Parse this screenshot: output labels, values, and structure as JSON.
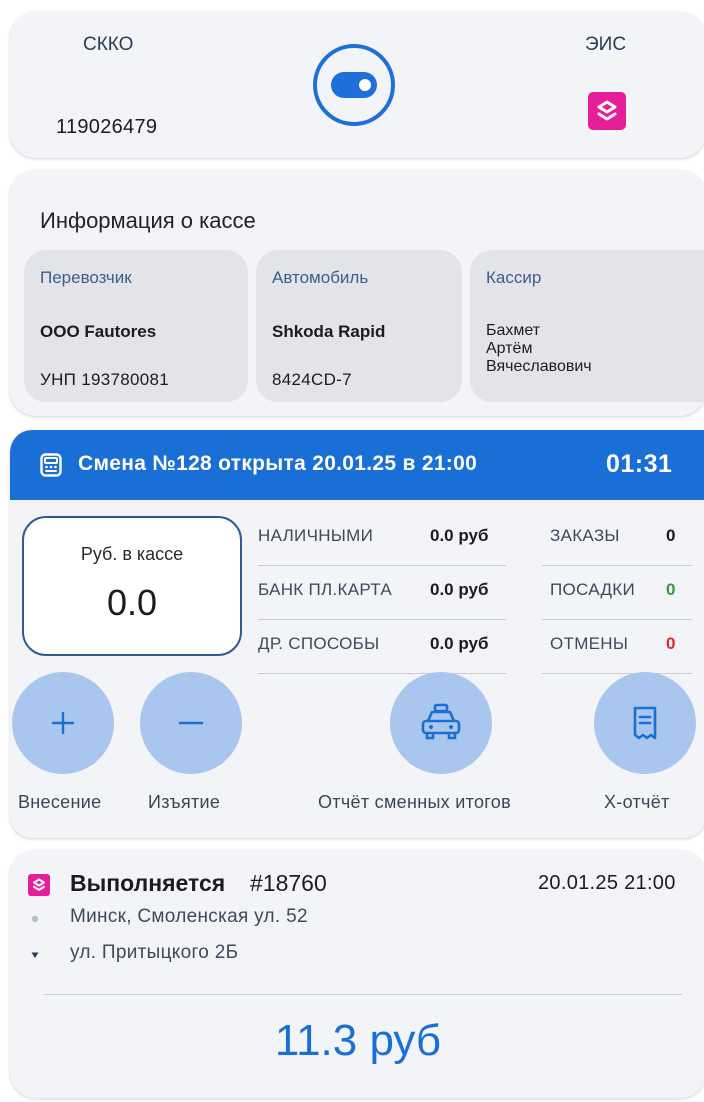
{
  "header": {
    "skko_label": "СККО",
    "skko_number": "119026479",
    "eis_label": "ЭИС",
    "toggle_state": "on",
    "accent_color": "#1e6fd9",
    "eis_logo_color": "#e51e9a"
  },
  "cash_info": {
    "title": "Информация о кассе",
    "carrier": {
      "caption": "Перевозчик",
      "name": "ООО Fautores",
      "unp": "УНП 193780081"
    },
    "car": {
      "caption": "Автомобиль",
      "model": "Shkoda Rapid",
      "plate": "8424CD-7"
    },
    "cashier": {
      "caption": "Кассир",
      "lines": [
        "Бахмет",
        "Артём",
        "Вячеславович"
      ]
    }
  },
  "shift": {
    "title": "Смена №128 открыта 20.01.25 в 21:00",
    "timer": "01:31",
    "icon": "cash-register-icon",
    "cash_label": "Руб. в кассе",
    "cash_value": "0.0",
    "payments": [
      {
        "label": "НАЛИЧНЫМИ",
        "value": "0.0 руб"
      },
      {
        "label": "БАНК ПЛ.КАРТА",
        "value": "0.0 руб"
      },
      {
        "label": "ДР. СПОСОБЫ",
        "value": "0.0 руб"
      }
    ],
    "counters": [
      {
        "label": "ЗАКАЗЫ",
        "value": "0",
        "color": "#1c1c1e"
      },
      {
        "label": "ПОСАДКИ",
        "value": "0",
        "color": "#2e9e3c"
      },
      {
        "label": "ОТМЕНЫ",
        "value": "0",
        "color": "#d92b2b"
      }
    ],
    "actions": {
      "deposit": "Внесение",
      "withdraw": "Изъятие",
      "shift_report": "Отчёт сменных итогов",
      "x_report": "Х-отчёт"
    }
  },
  "order": {
    "status": "Выполняется",
    "number": "#18760",
    "datetime": "20.01.25 21:00",
    "from": "Минск, Смоленская ул. 52",
    "to": "ул. Притыцкого 2Б",
    "price": "11.3 руб"
  }
}
